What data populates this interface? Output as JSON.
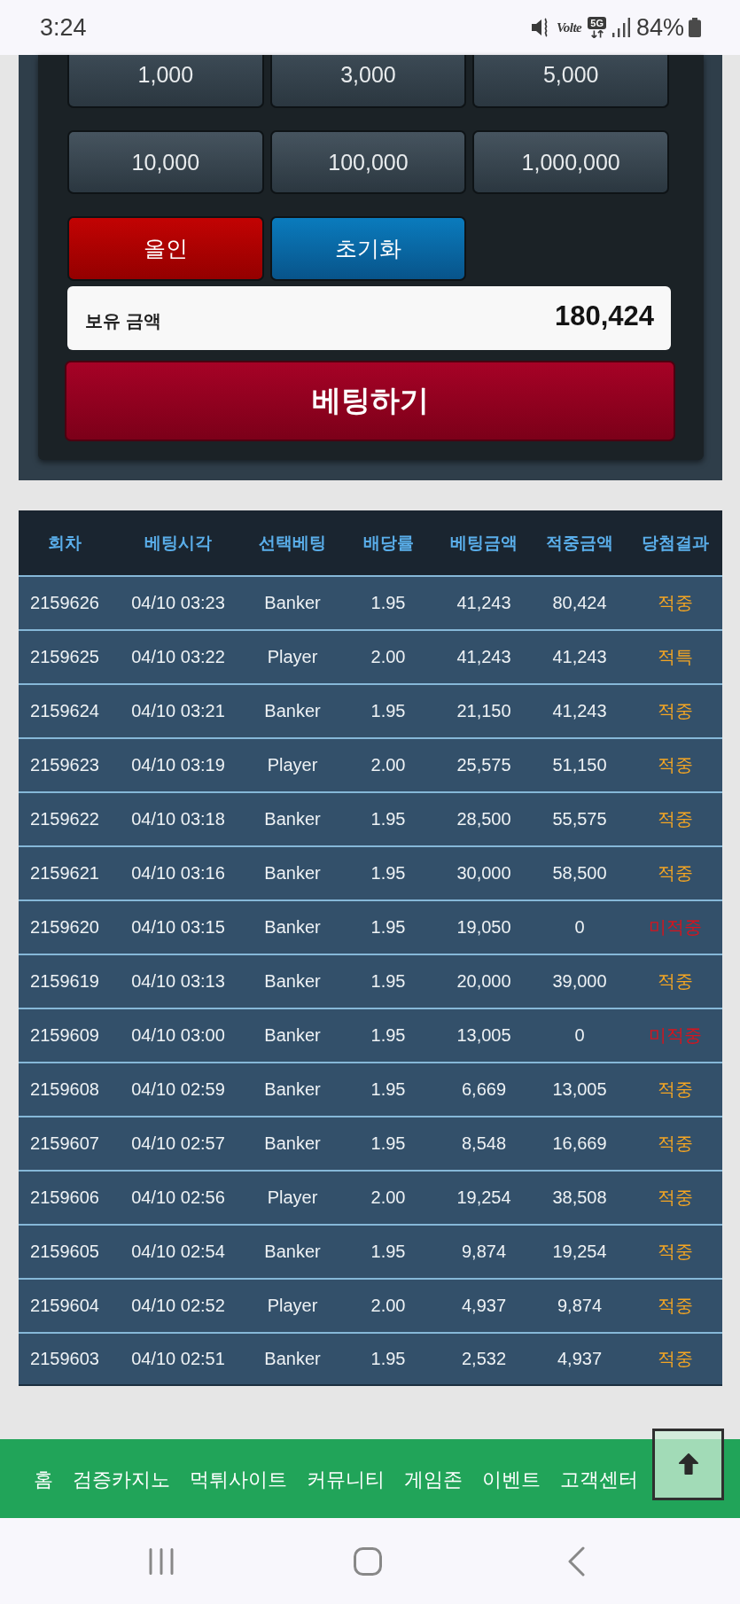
{
  "status_bar": {
    "time": "3:24",
    "volte": "Volte",
    "network": "5G",
    "battery": "84%"
  },
  "bet_panel": {
    "chips": [
      {
        "label": "1,000"
      },
      {
        "label": "3,000"
      },
      {
        "label": "5,000"
      },
      {
        "label": "10,000"
      },
      {
        "label": "100,000"
      },
      {
        "label": "1,000,000"
      }
    ],
    "actions": [
      {
        "label": "올인",
        "kind": "danger"
      },
      {
        "label": "초기화",
        "kind": "info"
      }
    ],
    "balance": {
      "label": "보유 금액",
      "value": "180,424"
    },
    "submit": "베팅하기"
  },
  "history_table": {
    "columns": [
      "회차",
      "베팅시각",
      "선택베팅",
      "배당률",
      "베팅금액",
      "적중금액",
      "당첨결과"
    ],
    "rows": [
      {
        "cells": [
          "2159626",
          "04/10 03:23",
          "Banker",
          "1.95",
          "41,243",
          "80,424"
        ],
        "result": {
          "text": "적중",
          "color": "#f5a623"
        }
      },
      {
        "cells": [
          "2159625",
          "04/10 03:22",
          "Player",
          "2.00",
          "41,243",
          "41,243"
        ],
        "result": {
          "text": "적특",
          "color": "#f5a623"
        }
      },
      {
        "cells": [
          "2159624",
          "04/10 03:21",
          "Banker",
          "1.95",
          "21,150",
          "41,243"
        ],
        "result": {
          "text": "적중",
          "color": "#f5a623"
        }
      },
      {
        "cells": [
          "2159623",
          "04/10 03:19",
          "Player",
          "2.00",
          "25,575",
          "51,150"
        ],
        "result": {
          "text": "적중",
          "color": "#f5a623"
        }
      },
      {
        "cells": [
          "2159622",
          "04/10 03:18",
          "Banker",
          "1.95",
          "28,500",
          "55,575"
        ],
        "result": {
          "text": "적중",
          "color": "#f5a623"
        }
      },
      {
        "cells": [
          "2159621",
          "04/10 03:16",
          "Banker",
          "1.95",
          "30,000",
          "58,500"
        ],
        "result": {
          "text": "적중",
          "color": "#f5a623"
        }
      },
      {
        "cells": [
          "2159620",
          "04/10 03:15",
          "Banker",
          "1.95",
          "19,050",
          "0"
        ],
        "result": {
          "text": "미적중",
          "color": "#d9131c"
        }
      },
      {
        "cells": [
          "2159619",
          "04/10 03:13",
          "Banker",
          "1.95",
          "20,000",
          "39,000"
        ],
        "result": {
          "text": "적중",
          "color": "#f5a623"
        }
      },
      {
        "cells": [
          "2159609",
          "04/10 03:00",
          "Banker",
          "1.95",
          "13,005",
          "0"
        ],
        "result": {
          "text": "미적중",
          "color": "#d9131c"
        }
      },
      {
        "cells": [
          "2159608",
          "04/10 02:59",
          "Banker",
          "1.95",
          "6,669",
          "13,005"
        ],
        "result": {
          "text": "적중",
          "color": "#f5a623"
        }
      },
      {
        "cells": [
          "2159607",
          "04/10 02:57",
          "Banker",
          "1.95",
          "8,548",
          "16,669"
        ],
        "result": {
          "text": "적중",
          "color": "#f5a623"
        }
      },
      {
        "cells": [
          "2159606",
          "04/10 02:56",
          "Player",
          "2.00",
          "19,254",
          "38,508"
        ],
        "result": {
          "text": "적중",
          "color": "#f5a623"
        }
      },
      {
        "cells": [
          "2159605",
          "04/10 02:54",
          "Banker",
          "1.95",
          "9,874",
          "19,254"
        ],
        "result": {
          "text": "적중",
          "color": "#f5a623"
        }
      },
      {
        "cells": [
          "2159604",
          "04/10 02:52",
          "Player",
          "2.00",
          "4,937",
          "9,874"
        ],
        "result": {
          "text": "적중",
          "color": "#f5a623"
        }
      },
      {
        "cells": [
          "2159603",
          "04/10 02:51",
          "Banker",
          "1.95",
          "2,532",
          "4,937"
        ],
        "result": {
          "text": "적중",
          "color": "#f5a623"
        }
      }
    ]
  },
  "footer_nav": {
    "items": [
      "홈",
      "검증카지노",
      "먹튀사이트",
      "커뮤니티",
      "게임존",
      "이벤트",
      "고객센터"
    ]
  }
}
